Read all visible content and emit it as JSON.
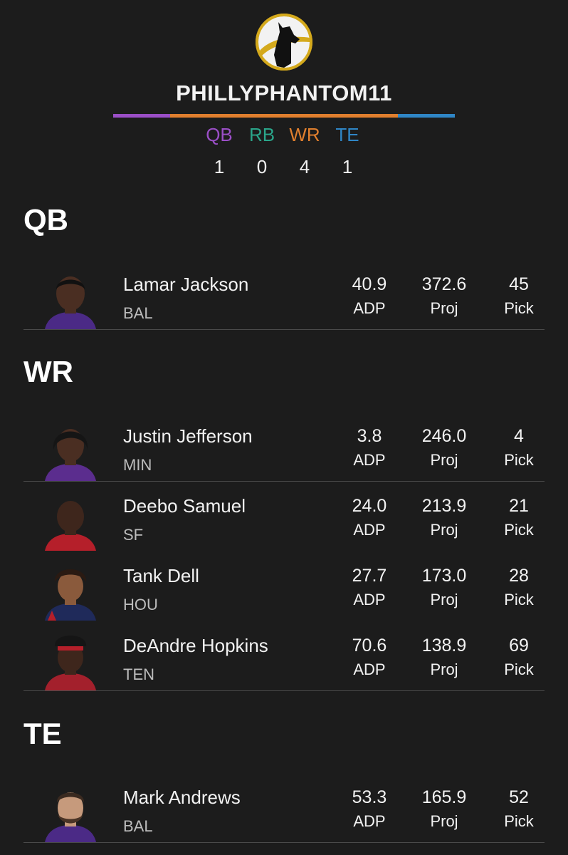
{
  "team": {
    "name": "PHILLYPHANTOM11",
    "logo_icon": "dog-silhouette-logo",
    "position_bar": [
      {
        "pos": "QB",
        "color": "#9b4fc7",
        "share": 0.1667
      },
      {
        "pos": "WR",
        "color": "#e07f2e",
        "share": 0.6667
      },
      {
        "pos": "TE",
        "color": "#2f86c6",
        "share": 0.1666
      }
    ]
  },
  "counts": [
    {
      "label": "QB",
      "value": "1",
      "color": "#9b4fc7"
    },
    {
      "label": "RB",
      "value": "0",
      "color": "#2aa58a"
    },
    {
      "label": "WR",
      "value": "4",
      "color": "#e07f2e"
    },
    {
      "label": "TE",
      "value": "1",
      "color": "#2f86c6"
    }
  ],
  "stat_labels": {
    "adp": "ADP",
    "proj": "Proj",
    "pick": "Pick"
  },
  "sections": [
    {
      "title": "QB",
      "players": [
        {
          "name": "Lamar Jackson",
          "team": "BAL",
          "adp": "40.9",
          "proj": "372.6",
          "pick": "45",
          "jersey": "#4b2a86"
        }
      ]
    },
    {
      "title": "WR",
      "players": [
        {
          "name": "Justin Jefferson",
          "team": "MIN",
          "adp": "3.8",
          "proj": "246.0",
          "pick": "4",
          "jersey": "#5b2d8e"
        },
        {
          "name": "Deebo Samuel",
          "team": "SF",
          "adp": "24.0",
          "proj": "213.9",
          "pick": "21",
          "jersey": "#b51f2a"
        },
        {
          "name": "Tank Dell",
          "team": "HOU",
          "adp": "27.7",
          "proj": "173.0",
          "pick": "28",
          "jersey": "#1f2a5a"
        },
        {
          "name": "DeAndre Hopkins",
          "team": "TEN",
          "adp": "70.6",
          "proj": "138.9",
          "pick": "69",
          "jersey": "#a3202c"
        }
      ]
    },
    {
      "title": "TE",
      "players": [
        {
          "name": "Mark Andrews",
          "team": "BAL",
          "adp": "53.3",
          "proj": "165.9",
          "pick": "52",
          "jersey": "#4b2a86"
        }
      ]
    }
  ]
}
